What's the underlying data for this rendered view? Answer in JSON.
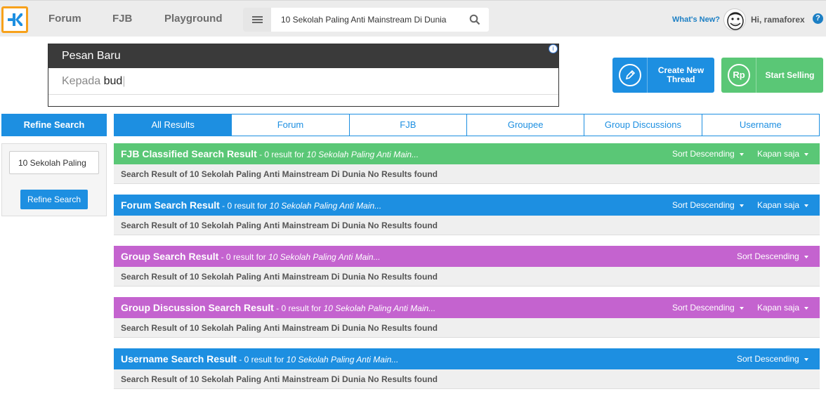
{
  "nav": {
    "forum": "Forum",
    "fjb": "FJB",
    "playground": "Playground",
    "search_value": "10 Sekolah Paling Anti Mainstream Di Dunia",
    "whats_new": "What's New?",
    "greeting": "Hi, ramaforex",
    "help": "?"
  },
  "ad": {
    "title": "Pesan Baru",
    "to_label": "Kepada",
    "to_value": "bud",
    "info": "i"
  },
  "actions": {
    "create_thread": "Create New Thread",
    "start_selling": "Start Selling",
    "rp_glyph": "Rp"
  },
  "sidebar": {
    "heading": "Refine Search",
    "input_value": "10 Sekolah Paling",
    "button": "Refine Search"
  },
  "tabs": [
    "All Results",
    "Forum",
    "FJB",
    "Groupee",
    "Group Discussions",
    "Username"
  ],
  "sections": [
    {
      "title": "FJB Classified Search Result",
      "meta": " - 0 result for ",
      "query": "10 Sekolah Paling Anti Main...",
      "sort": "Sort Descending",
      "time": "Kapan saja",
      "color": "#5ac776",
      "body": "Search Result of 10 Sekolah Paling Anti Mainstream Di Dunia No Results found"
    },
    {
      "title": "Forum Search Result",
      "meta": " - 0 result for ",
      "query": "10 Sekolah Paling Anti Main...",
      "sort": "Sort Descending",
      "time": "Kapan saja",
      "color": "#1d8fe1",
      "body": "Search Result of 10 Sekolah Paling Anti Mainstream Di Dunia No Results found"
    },
    {
      "title": "Group Search Result",
      "meta": " - 0 result for ",
      "query": "10 Sekolah Paling Anti Main...",
      "sort": "Sort Descending",
      "time": "",
      "color": "#c463cf",
      "body": "Search Result of 10 Sekolah Paling Anti Mainstream Di Dunia No Results found"
    },
    {
      "title": "Group Discussion Search Result",
      "meta": " - 0 result for ",
      "query": "10 Sekolah Paling Anti Main...",
      "sort": "Sort Descending",
      "time": "Kapan saja",
      "color": "#c463cf",
      "body": "Search Result of 10 Sekolah Paling Anti Mainstream Di Dunia No Results found"
    },
    {
      "title": "Username Search Result",
      "meta": " - 0 result for ",
      "query": "10 Sekolah Paling Anti Main...",
      "sort": "Sort Descending",
      "time": "",
      "color": "#1d8fe1",
      "body": "Search Result of 10 Sekolah Paling Anti Mainstream Di Dunia No Results found"
    }
  ],
  "colors": {
    "primary": "#1d8fe1",
    "green": "#5ac776",
    "purple": "#c463cf",
    "logo_border": "#f7a11b"
  }
}
